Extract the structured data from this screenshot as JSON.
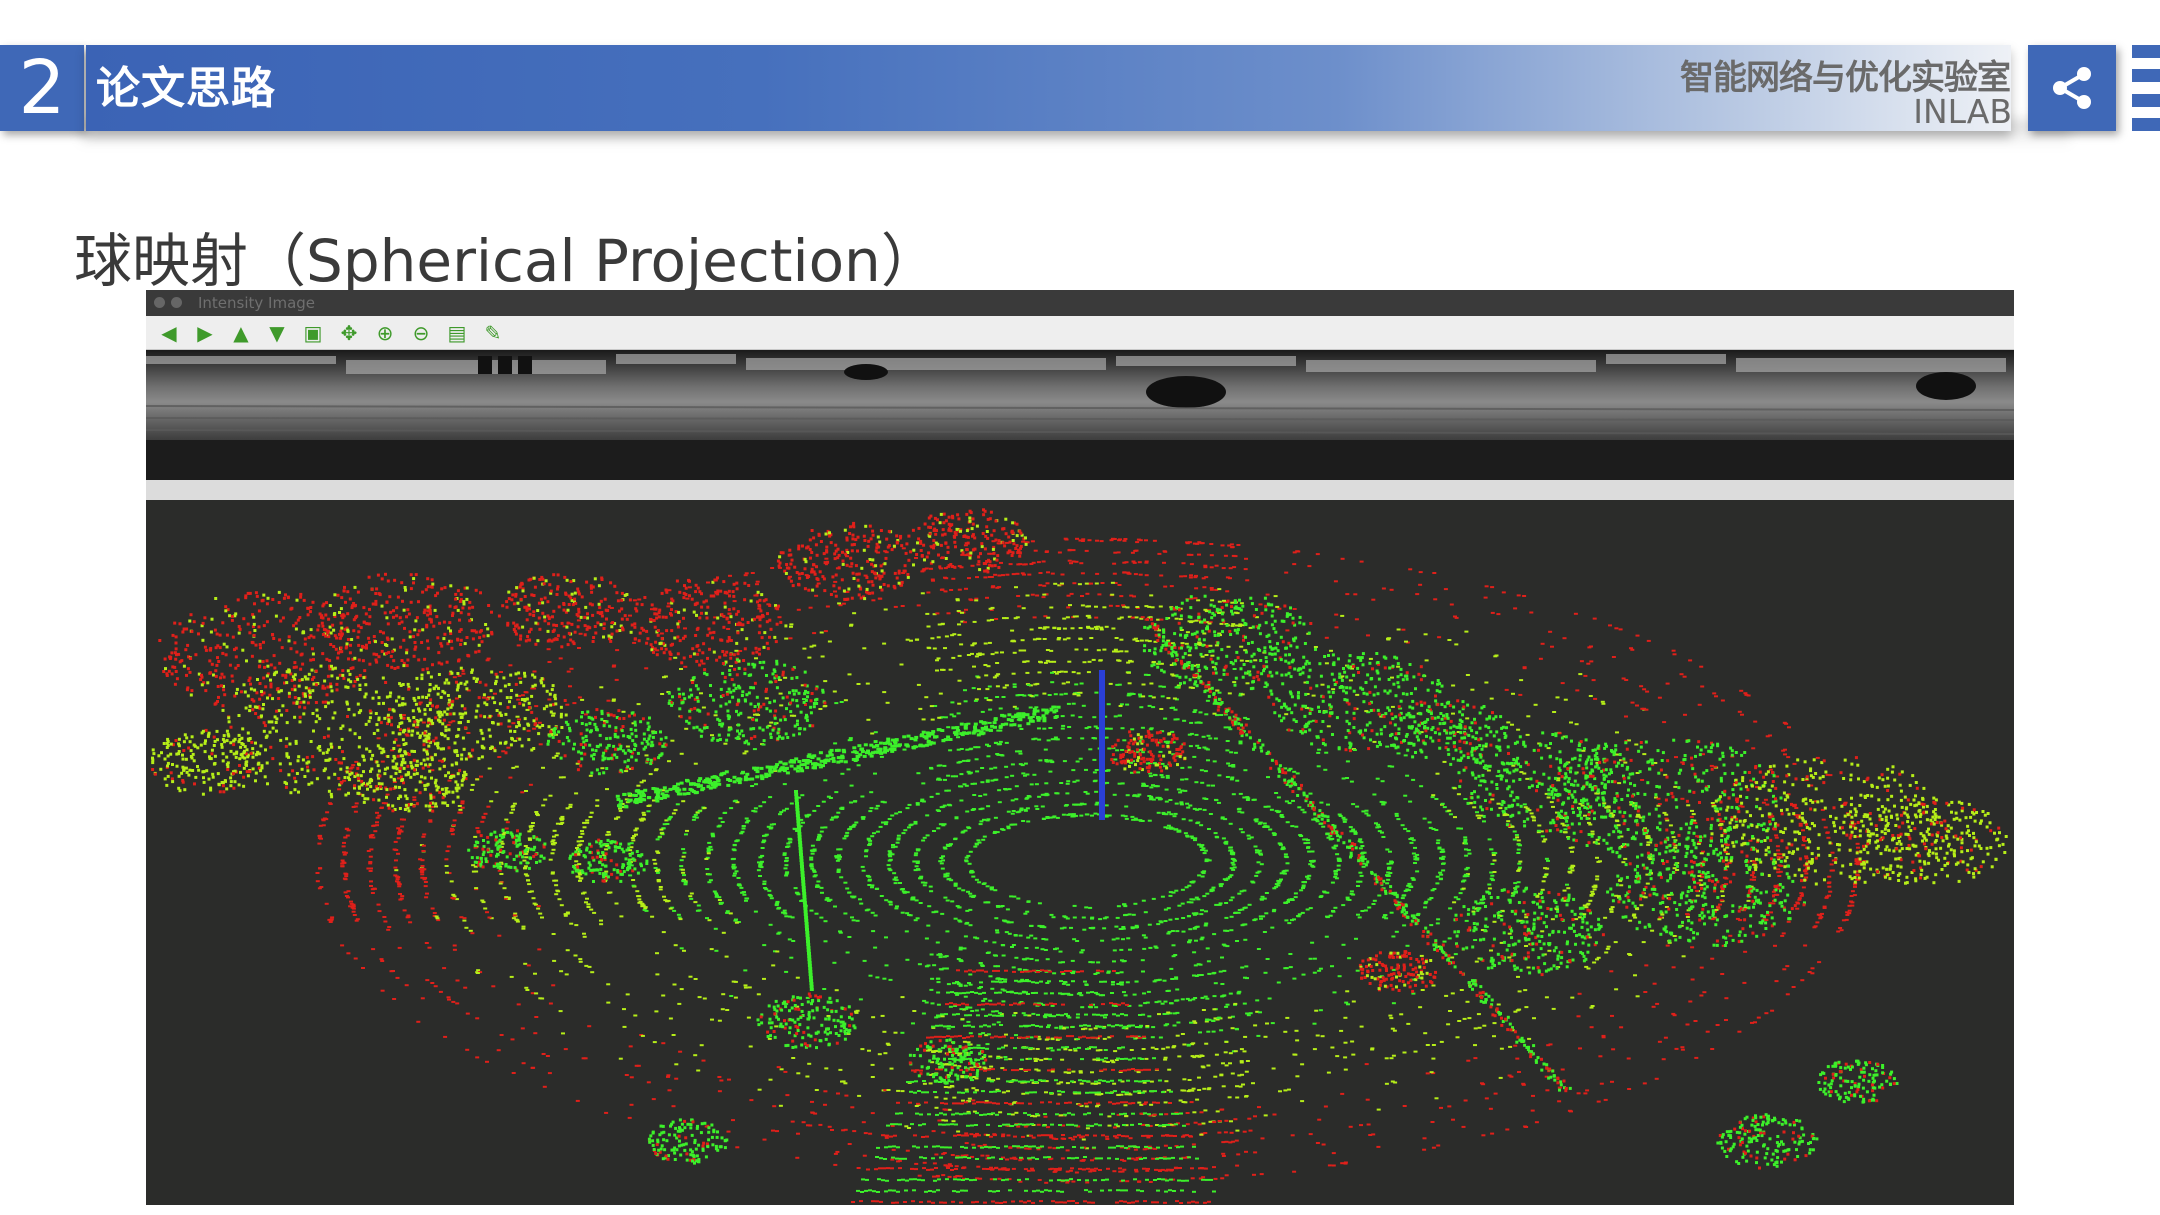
{
  "header": {
    "section_number": "2",
    "section_title": "论文思路",
    "lab_name_cn": "智能网络与优化实验室",
    "lab_name_en": "INLAB",
    "share_icon": "share-icon"
  },
  "heading": "球映射（Spherical Projection）",
  "figure": {
    "window_title": "Intensity Image",
    "toolbar_icons": [
      "arrow-left-icon",
      "arrow-right-icon",
      "arrow-up-icon",
      "arrow-down-icon",
      "save-image-icon",
      "pan-icon",
      "zoom-in-icon",
      "zoom-out-icon",
      "save-icon",
      "edit-icon"
    ],
    "colors": {
      "background": "#2b2c2a",
      "near_points": "#3cf02a",
      "mid_points": "#b6ee18",
      "far_points": "#e0201a",
      "accent_blue": "#2a3fd6",
      "header_blue": "#3f68b7"
    }
  }
}
